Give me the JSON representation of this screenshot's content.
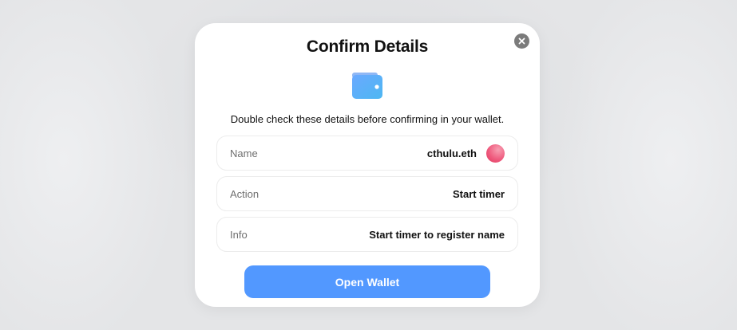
{
  "modal": {
    "title": "Confirm Details",
    "subtitle": "Double check these details before confirming in your wallet.",
    "close_icon": "close-icon",
    "wallet_icon": "wallet-icon",
    "rows": [
      {
        "label": "Name",
        "value": "cthulu.eth",
        "has_avatar": true
      },
      {
        "label": "Action",
        "value": "Start timer"
      },
      {
        "label": "Info",
        "value": "Start timer to register name"
      }
    ],
    "primary_button": "Open Wallet"
  },
  "colors": {
    "primary": "#5298ff",
    "close_bg": "#7b7b7b",
    "avatar": "#ef5b7e"
  }
}
